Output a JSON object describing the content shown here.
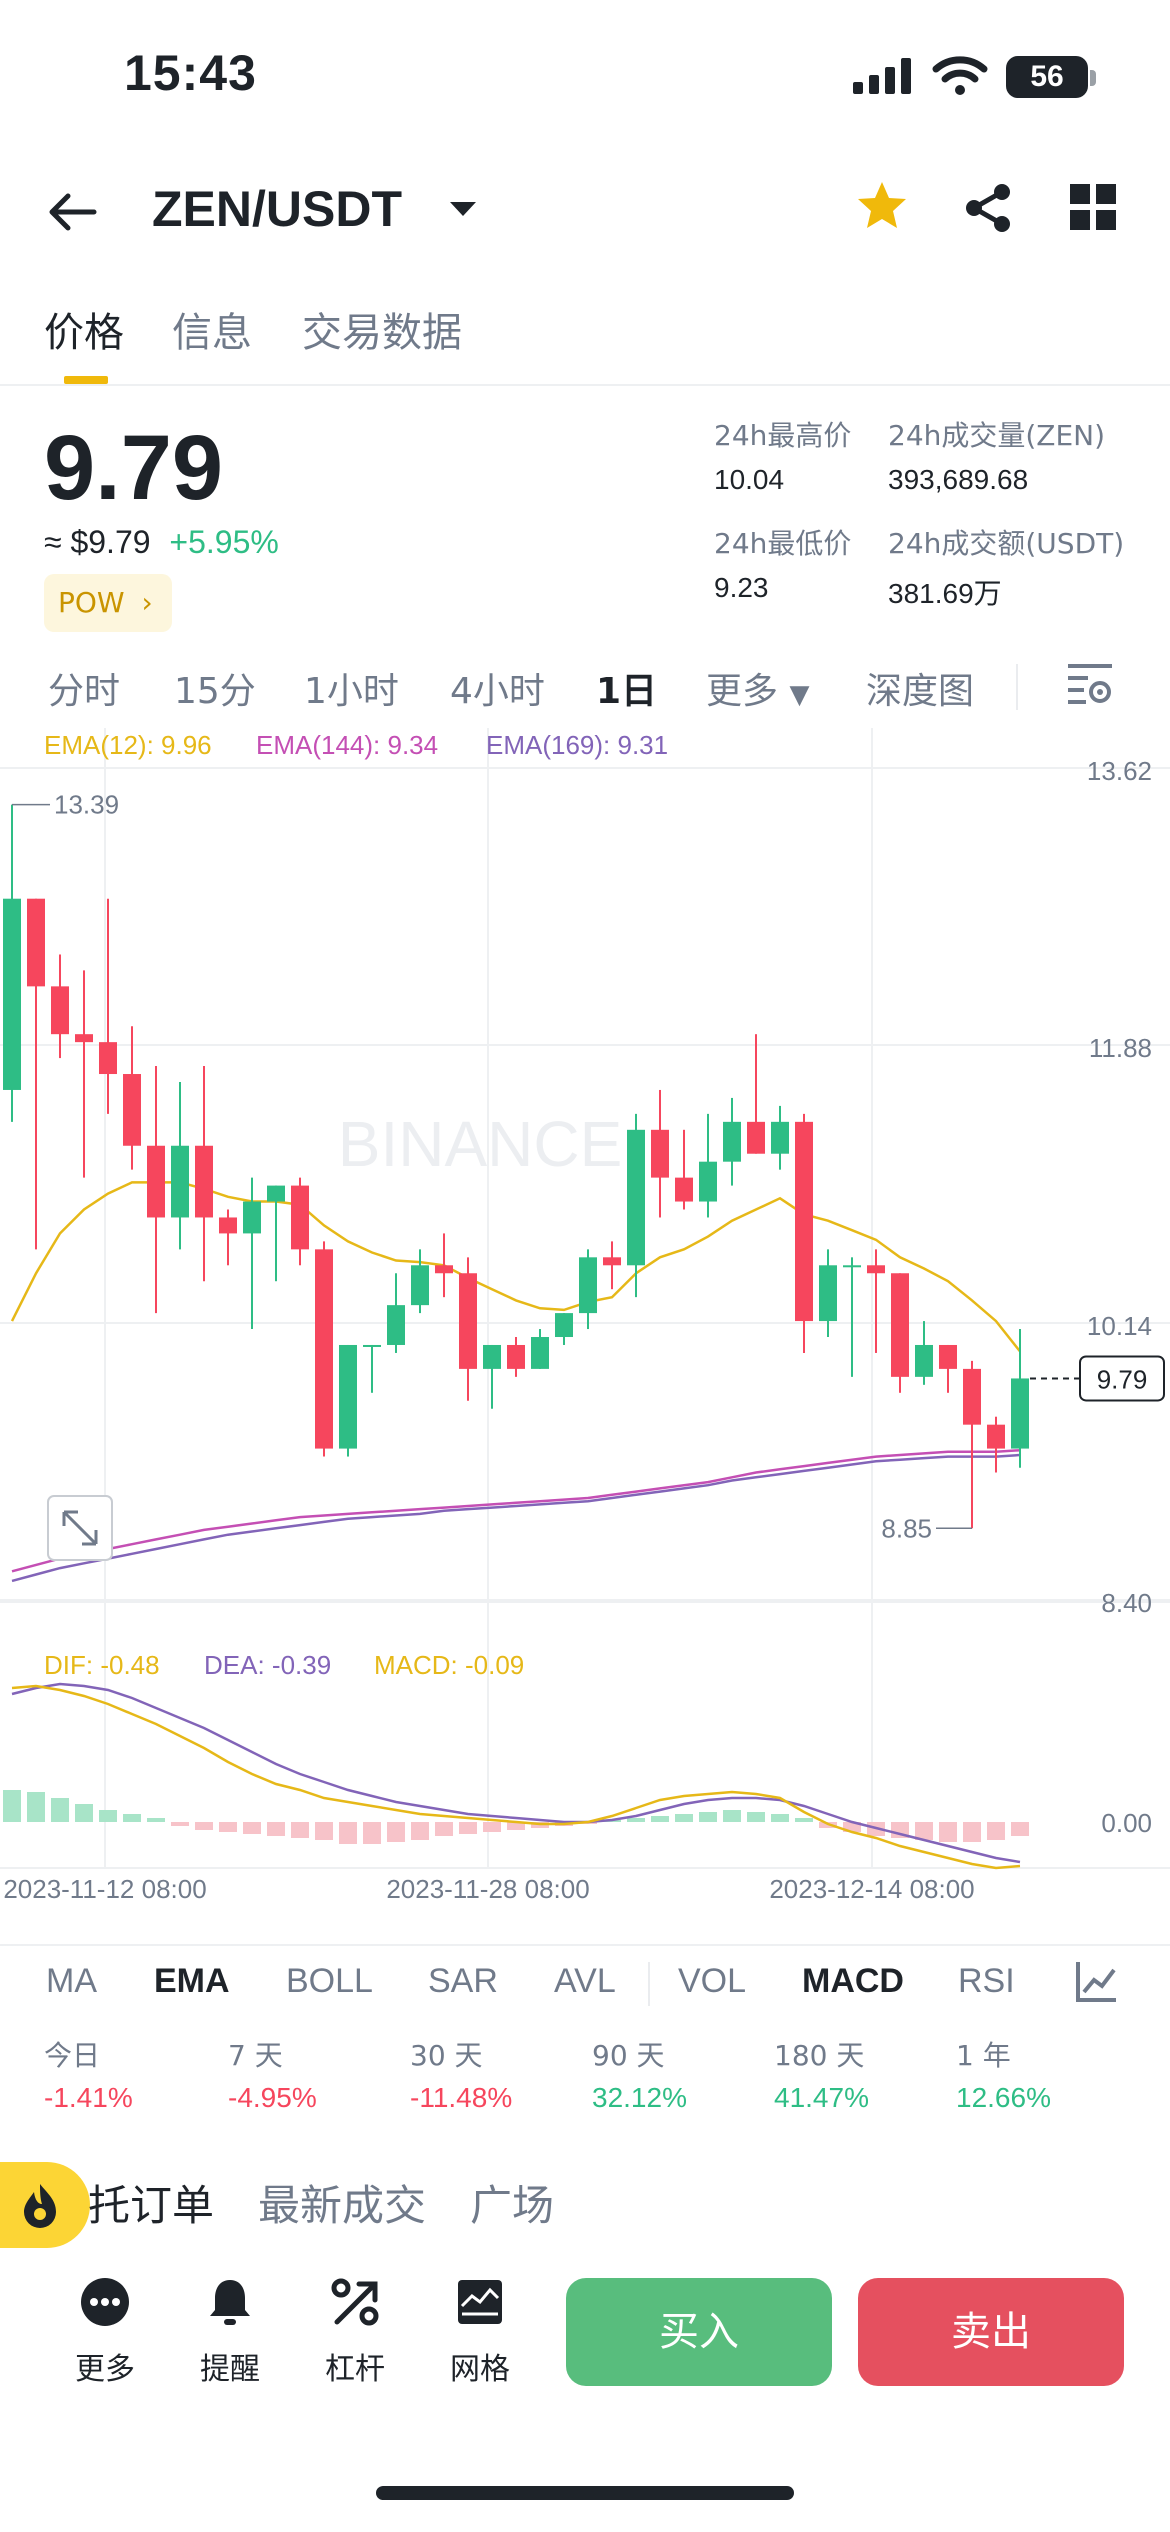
{
  "status_bar": {
    "time": "15:43",
    "battery": "56"
  },
  "header": {
    "pair": "ZEN/USDT"
  },
  "tabs": [
    {
      "label": "价格",
      "active": true
    },
    {
      "label": "信息",
      "active": false
    },
    {
      "label": "交易数据",
      "active": false
    }
  ],
  "price": {
    "last": "9.79",
    "fiat": "≈ $9.79",
    "change": "+5.95%",
    "tag": "POW"
  },
  "stats": {
    "high_label": "24h最高价",
    "high_value": "10.04",
    "vol_base_label": "24h成交量(ZEN)",
    "vol_base_value": "393,689.68",
    "low_label": "24h最低价",
    "low_value": "9.23",
    "vol_quote_label": "24h成交额(USDT)",
    "vol_quote_value": "381.69万"
  },
  "intervals": [
    {
      "label": "分时",
      "active": false
    },
    {
      "label": "15分",
      "active": false
    },
    {
      "label": "1小时",
      "active": false
    },
    {
      "label": "4小时",
      "active": false
    },
    {
      "label": "1日",
      "active": true
    },
    {
      "label": "更多",
      "active": false
    },
    {
      "label": "深度图",
      "active": false
    }
  ],
  "chart_data": {
    "type": "candlestick",
    "ema_labels": [
      "EMA(12): 9.96",
      "EMA(144): 9.34",
      "EMA(169): 9.31"
    ],
    "y_ticks": [
      "13.62",
      "11.88",
      "10.14",
      "8.40"
    ],
    "x_ticks": [
      "2023-11-12 08:00",
      "2023-11-28 08:00",
      "2023-12-14 08:00"
    ],
    "high_marker": "13.39",
    "low_marker": "8.85",
    "last_price_label": "9.79",
    "watermark": "BINANCE",
    "macd_labels": [
      "DIF: -0.48",
      "DEA: -0.39",
      "MACD: -0.09"
    ],
    "macd_zero_tick": "0.00",
    "candles": [
      {
        "o": 11.6,
        "h": 13.39,
        "l": 11.4,
        "c": 12.8
      },
      {
        "o": 12.8,
        "h": 12.8,
        "l": 10.6,
        "c": 12.25
      },
      {
        "o": 12.25,
        "h": 12.45,
        "l": 11.8,
        "c": 11.95
      },
      {
        "o": 11.95,
        "h": 12.35,
        "l": 11.05,
        "c": 11.9
      },
      {
        "o": 11.9,
        "h": 12.8,
        "l": 11.45,
        "c": 11.7
      },
      {
        "o": 11.7,
        "h": 12.0,
        "l": 11.1,
        "c": 11.25
      },
      {
        "o": 11.25,
        "h": 11.75,
        "l": 10.2,
        "c": 10.8
      },
      {
        "o": 10.8,
        "h": 11.65,
        "l": 10.6,
        "c": 11.25
      },
      {
        "o": 11.25,
        "h": 11.75,
        "l": 10.4,
        "c": 10.8
      },
      {
        "o": 10.8,
        "h": 10.85,
        "l": 10.5,
        "c": 10.7
      },
      {
        "o": 10.7,
        "h": 11.05,
        "l": 10.1,
        "c": 10.9
      },
      {
        "o": 10.9,
        "h": 11.0,
        "l": 10.4,
        "c": 11.0
      },
      {
        "o": 11.0,
        "h": 11.05,
        "l": 10.5,
        "c": 10.6
      },
      {
        "o": 10.6,
        "h": 10.65,
        "l": 9.3,
        "c": 9.35
      },
      {
        "o": 9.35,
        "h": 10.0,
        "l": 9.3,
        "c": 10.0
      },
      {
        "o": 10.0,
        "h": 10.0,
        "l": 9.7,
        "c": 10.0
      },
      {
        "o": 10.0,
        "h": 10.45,
        "l": 9.95,
        "c": 10.25
      },
      {
        "o": 10.25,
        "h": 10.6,
        "l": 10.2,
        "c": 10.5
      },
      {
        "o": 10.5,
        "h": 10.7,
        "l": 10.3,
        "c": 10.45
      },
      {
        "o": 10.45,
        "h": 10.55,
        "l": 9.65,
        "c": 9.85
      },
      {
        "o": 9.85,
        "h": 10.0,
        "l": 9.6,
        "c": 10.0
      },
      {
        "o": 10.0,
        "h": 10.05,
        "l": 9.8,
        "c": 9.85
      },
      {
        "o": 9.85,
        "h": 10.1,
        "l": 9.85,
        "c": 10.05
      },
      {
        "o": 10.05,
        "h": 10.2,
        "l": 10.0,
        "c": 10.2
      },
      {
        "o": 10.2,
        "h": 10.6,
        "l": 10.1,
        "c": 10.55
      },
      {
        "o": 10.55,
        "h": 10.65,
        "l": 10.35,
        "c": 10.5
      },
      {
        "o": 10.5,
        "h": 11.45,
        "l": 10.3,
        "c": 11.35
      },
      {
        "o": 11.35,
        "h": 11.6,
        "l": 10.8,
        "c": 11.05
      },
      {
        "o": 11.05,
        "h": 11.35,
        "l": 10.85,
        "c": 10.9
      },
      {
        "o": 10.9,
        "h": 11.45,
        "l": 10.8,
        "c": 11.15
      },
      {
        "o": 11.15,
        "h": 11.55,
        "l": 11.0,
        "c": 11.4
      },
      {
        "o": 11.4,
        "h": 11.95,
        "l": 11.2,
        "c": 11.2
      },
      {
        "o": 11.2,
        "h": 11.5,
        "l": 11.1,
        "c": 11.4
      },
      {
        "o": 11.4,
        "h": 11.45,
        "l": 9.95,
        "c": 10.15
      },
      {
        "o": 10.15,
        "h": 10.6,
        "l": 10.05,
        "c": 10.5
      },
      {
        "o": 10.5,
        "h": 10.55,
        "l": 9.8,
        "c": 10.5
      },
      {
        "o": 10.5,
        "h": 10.6,
        "l": 9.95,
        "c": 10.45
      },
      {
        "o": 10.45,
        "h": 10.45,
        "l": 9.7,
        "c": 9.8
      },
      {
        "o": 9.8,
        "h": 10.15,
        "l": 9.75,
        "c": 10.0
      },
      {
        "o": 10.0,
        "h": 10.0,
        "l": 9.7,
        "c": 9.85
      },
      {
        "o": 9.85,
        "h": 9.9,
        "l": 8.85,
        "c": 9.5
      },
      {
        "o": 9.5,
        "h": 9.55,
        "l": 9.2,
        "c": 9.35
      },
      {
        "o": 9.35,
        "h": 10.1,
        "l": 9.23,
        "c": 9.79
      }
    ],
    "ema12": [
      10.15,
      10.45,
      10.7,
      10.85,
      10.95,
      11.02,
      11.02,
      11.02,
      10.98,
      10.93,
      10.9,
      10.9,
      10.88,
      10.75,
      10.65,
      10.58,
      10.53,
      10.52,
      10.5,
      10.42,
      10.35,
      10.28,
      10.23,
      10.22,
      10.27,
      10.3,
      10.45,
      10.55,
      10.6,
      10.68,
      10.78,
      10.85,
      10.92,
      10.82,
      10.78,
      10.72,
      10.66,
      10.55,
      10.48,
      10.4,
      10.28,
      10.15,
      9.96
    ],
    "ema144": [
      8.58,
      8.62,
      8.66,
      8.69,
      8.72,
      8.75,
      8.78,
      8.81,
      8.84,
      8.86,
      8.88,
      8.9,
      8.92,
      8.93,
      8.94,
      8.95,
      8.96,
      8.97,
      8.98,
      8.99,
      9.0,
      9.01,
      9.02,
      9.03,
      9.04,
      9.06,
      9.08,
      9.1,
      9.12,
      9.14,
      9.17,
      9.2,
      9.22,
      9.24,
      9.26,
      9.28,
      9.3,
      9.31,
      9.32,
      9.33,
      9.33,
      9.33,
      9.34
    ],
    "ema169": [
      8.52,
      8.56,
      8.6,
      8.63,
      8.66,
      8.69,
      8.72,
      8.75,
      8.78,
      8.81,
      8.83,
      8.85,
      8.87,
      8.89,
      8.91,
      8.92,
      8.93,
      8.94,
      8.96,
      8.97,
      8.98,
      8.99,
      9.0,
      9.01,
      9.02,
      9.04,
      9.06,
      9.08,
      9.1,
      9.12,
      9.15,
      9.17,
      9.19,
      9.21,
      9.23,
      9.25,
      9.27,
      9.28,
      9.29,
      9.3,
      9.3,
      9.3,
      9.31
    ]
  },
  "indicators": [
    {
      "label": "MA",
      "active": false
    },
    {
      "label": "EMA",
      "active": true
    },
    {
      "label": "BOLL",
      "active": false
    },
    {
      "label": "SAR",
      "active": false
    },
    {
      "label": "AVL",
      "active": false
    },
    {
      "label": "VOL",
      "active": false
    },
    {
      "label": "MACD",
      "active": true
    },
    {
      "label": "RSI",
      "active": false
    }
  ],
  "performance": [
    {
      "label": "今日",
      "value": "-1.41%",
      "dir": "neg"
    },
    {
      "label": "7 天",
      "value": "-4.95%",
      "dir": "neg"
    },
    {
      "label": "30 天",
      "value": "-11.48%",
      "dir": "neg"
    },
    {
      "label": "90 天",
      "value": "32.12%",
      "dir": "pos"
    },
    {
      "label": "180 天",
      "value": "41.47%",
      "dir": "pos"
    },
    {
      "label": "1 年",
      "value": "12.66%",
      "dir": "pos"
    }
  ],
  "subtabs": [
    {
      "label": "托订单",
      "active": true
    },
    {
      "label": "最新成交",
      "active": false
    },
    {
      "label": "广场",
      "active": false
    }
  ],
  "actions": [
    {
      "label": "更多",
      "icon": "more-icon"
    },
    {
      "label": "提醒",
      "icon": "bell-icon"
    },
    {
      "label": "杠杆",
      "icon": "leverage-icon"
    },
    {
      "label": "网格",
      "icon": "grid-bot-icon"
    }
  ],
  "buy_label": "买入",
  "sell_label": "卖出",
  "colors": {
    "up": "#2ebd85",
    "down": "#f6465d",
    "accent": "#f0b90b",
    "ema12": "#e6b818",
    "ema144": "#c44fb4",
    "ema169": "#8264b8"
  }
}
